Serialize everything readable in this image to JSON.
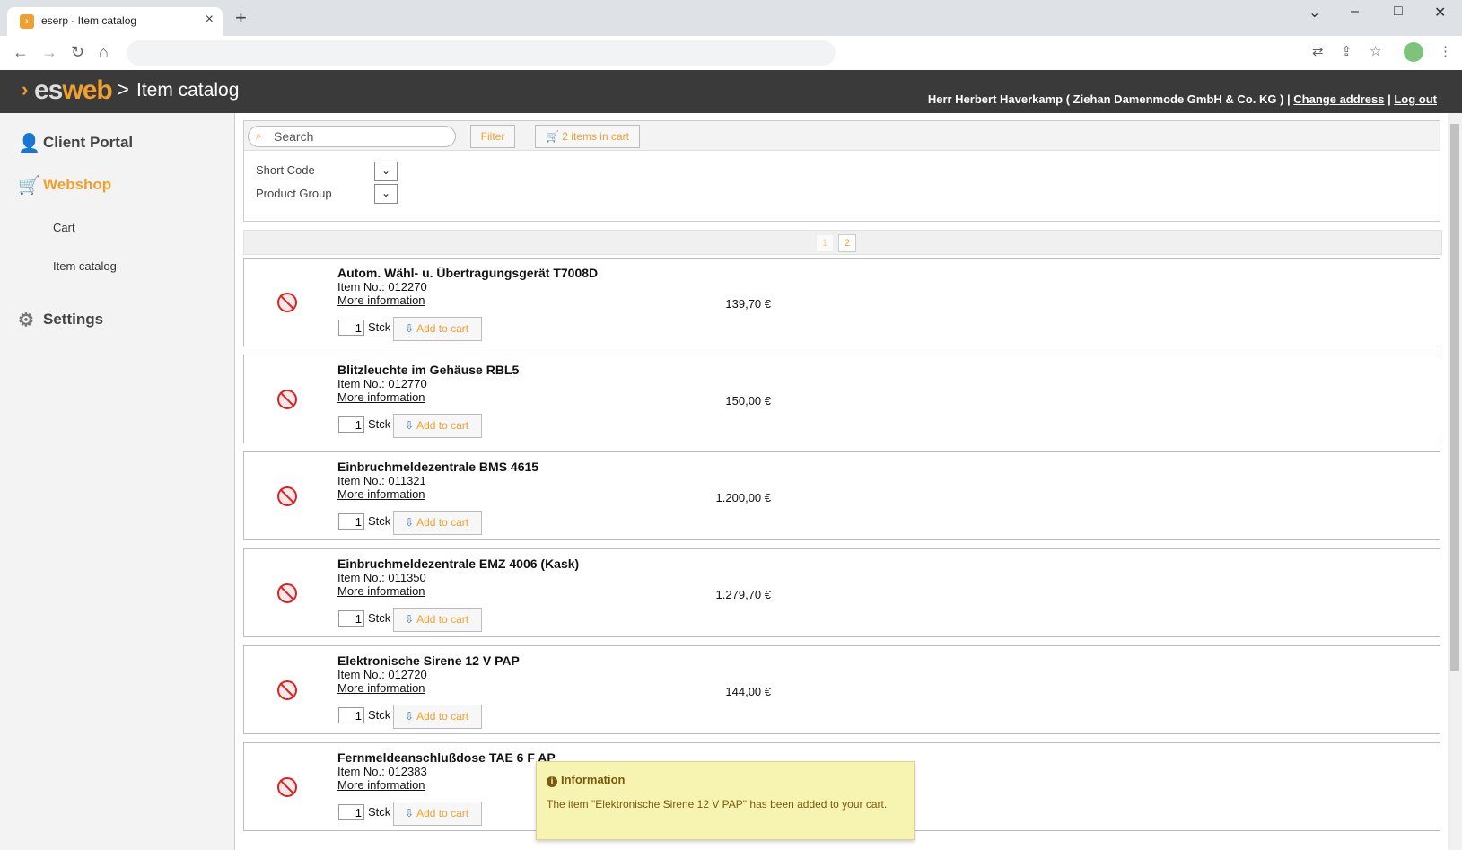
{
  "browser": {
    "tab_title": "eserp - Item catalog",
    "new_tab": "+",
    "close": "×"
  },
  "app": {
    "logo_es": "es",
    "logo_web": "web",
    "separator": ">",
    "page_title": "Item catalog",
    "user": "Herr Herbert Haverkamp ( Ziehan Damenmode GmbH & Co. KG ) |",
    "change_address": "Change address",
    "divider": "|",
    "logout": "Log out"
  },
  "sidebar": {
    "client_portal": "Client Portal",
    "webshop": "Webshop",
    "cart": "Cart",
    "item_catalog": "Item catalog",
    "settings": "Settings"
  },
  "search": {
    "placeholder": "Search",
    "filter_button": "Filter",
    "cart_button": "2 items in cart",
    "short_code_label": "Short Code",
    "product_group_label": "Product Group"
  },
  "pager": {
    "page1": "1",
    "page2": "2"
  },
  "items": [
    {
      "name": "Autom. Wähl- u. Übertragungsgerät T7008D",
      "item_no": "Item No.: 012270",
      "more": "More information",
      "qty": "1",
      "unit": "Stck",
      "add": "Add to cart",
      "price": "139,70 €"
    },
    {
      "name": "Blitzleuchte im Gehäuse RBL5",
      "item_no": "Item No.: 012770",
      "more": "More information",
      "qty": "1",
      "unit": "Stck",
      "add": "Add to cart",
      "price": "150,00 €"
    },
    {
      "name": "Einbruchmeldezentrale BMS 4615",
      "item_no": "Item No.: 011321",
      "more": "More information",
      "qty": "1",
      "unit": "Stck",
      "add": "Add to cart",
      "price": "1.200,00 €"
    },
    {
      "name": "Einbruchmeldezentrale EMZ 4006 (Kask)",
      "item_no": "Item No.: 011350",
      "more": "More information",
      "qty": "1",
      "unit": "Stck",
      "add": "Add to cart",
      "price": "1.279,70 €"
    },
    {
      "name": "Elektronische Sirene 12 V PAP",
      "item_no": "Item No.: 012720",
      "more": "More information",
      "qty": "1",
      "unit": "Stck",
      "add": "Add to cart",
      "price": "144,00 €"
    },
    {
      "name": "Fernmeldeanschlußdose TAE 6 F AP",
      "item_no": "Item No.: 012383",
      "more": "More information",
      "qty": "1",
      "unit": "Stck",
      "add": "Add to cart",
      "price": ""
    }
  ],
  "notice": {
    "title": "Information",
    "text": "The item \"Elektronische Sirene 12 V PAP\" has been added to your cart."
  }
}
